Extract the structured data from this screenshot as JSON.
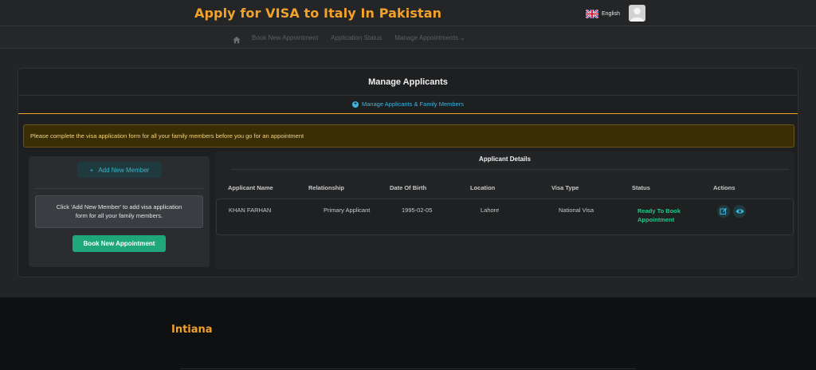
{
  "header": {
    "title": "Apply for VISA to Italy In Pakistan",
    "language": "English"
  },
  "nav": {
    "items": [
      "Book New Appointment",
      "Application Status",
      "Manage Appointments ⌄"
    ]
  },
  "card": {
    "title": "Manage Applicants",
    "tab_label": "Manage Applicants & Family Members",
    "alert": "Please complete the visa application form for all your family members before you go for an appointment"
  },
  "left_panel": {
    "add_member_label": "Add New Member",
    "info_line1": "Click 'Add New Member' to add visa application",
    "info_line2": "form for all your family members.",
    "book_button": "Book New Appointment"
  },
  "details": {
    "title": "Applicant Details",
    "columns": [
      "Applicant Name",
      "Relationship",
      "Date Of Birth",
      "Location",
      "Visa Type",
      "Status",
      "Actions"
    ],
    "rows": [
      {
        "name": "KHAN FARHAN",
        "relationship": "Primary Applicant",
        "dob": "1995-02-05",
        "location": "Lahore",
        "visa_type": "National Visa",
        "status_line1": "Ready To Book",
        "status_line2": "Appointment"
      }
    ]
  },
  "footer": {
    "brand": "Intiana"
  },
  "colors": {
    "accent": "#f2a22a",
    "link": "#3bb6e0",
    "success": "#1fca8a",
    "button": "#1fa77a"
  },
  "icons": [
    "home-icon",
    "info-circle-icon",
    "plus-icon",
    "edit-icon",
    "eye-icon",
    "uk-flag-icon",
    "avatar-icon"
  ]
}
